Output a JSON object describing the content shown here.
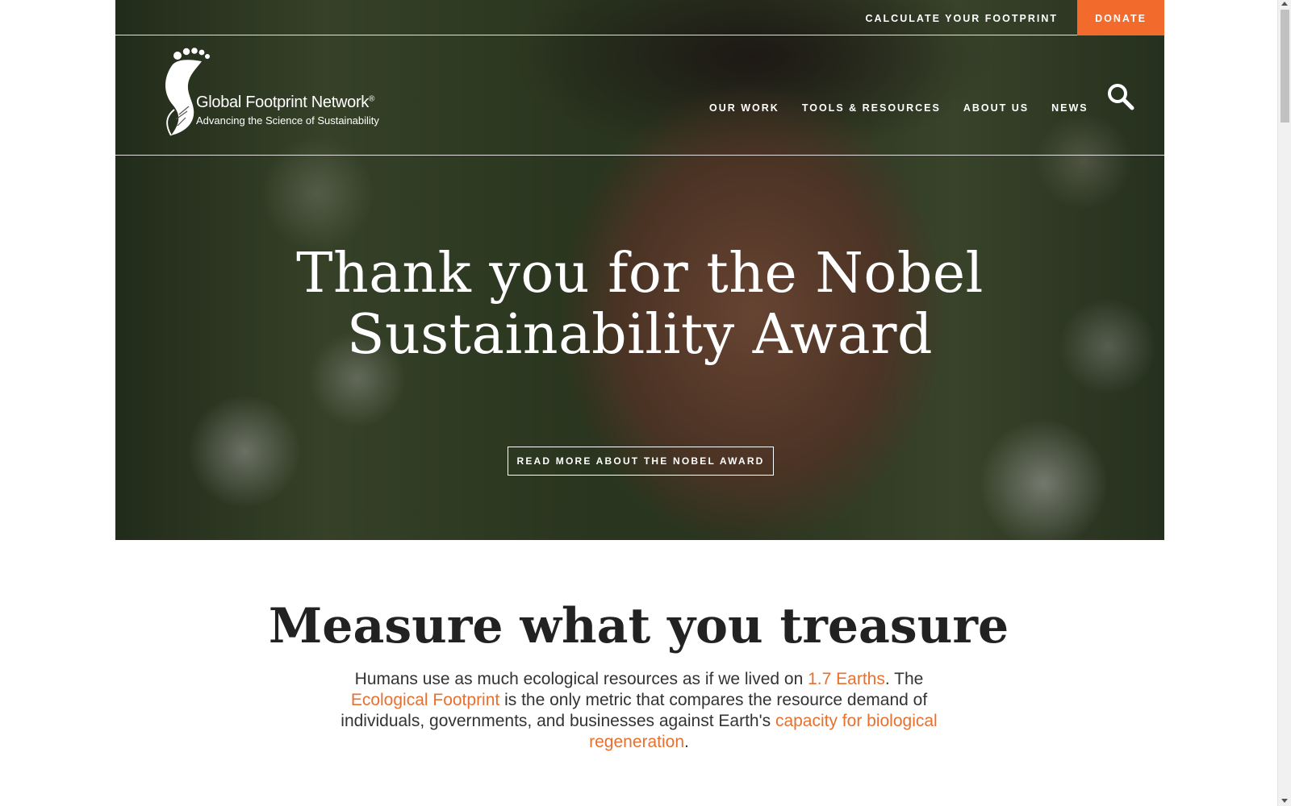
{
  "header": {
    "calculate_label": "CALCULATE YOUR FOOTPRINT",
    "donate_label": "DONATE",
    "brand": {
      "name": "Global Footprint Network",
      "registered_mark": "®",
      "tagline": "Advancing the Science of Sustainability"
    },
    "nav": [
      {
        "label": "OUR WORK"
      },
      {
        "label": "TOOLS & RESOURCES"
      },
      {
        "label": "ABOUT US"
      },
      {
        "label": "NEWS"
      }
    ],
    "search_icon": "search-icon"
  },
  "hero": {
    "title_line1": "Thank you for the Nobel",
    "title_line2": "Sustainability Award",
    "cta_label": "READ MORE ABOUT THE NOBEL AWARD"
  },
  "section": {
    "heading": "Measure what you treasure",
    "intro": {
      "part1": "Humans use as much ecological resources as if we lived on ",
      "link1": "1.7 Earths",
      "part2": ". The ",
      "link2": "Ecological Footprint",
      "part3": " is the only metric that compares the resource demand of individuals, governments, and businesses against Earth's ",
      "link3": "capacity for biological regeneration",
      "part4": "."
    }
  },
  "colors": {
    "accent": "#f26b2d",
    "link": "#e8702f",
    "heading": "#222222",
    "body_text": "#333333"
  }
}
